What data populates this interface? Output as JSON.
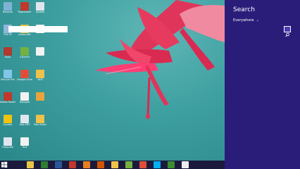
{
  "desktop_icons": [
    {
      "label": "Network",
      "color": "#7fb3d5"
    },
    {
      "label": "Pagemaker",
      "color": "#c0392b"
    },
    {
      "label": "Update",
      "color": "#dfe6ee"
    },
    {
      "label": "This PC",
      "color": "#8fb8de"
    },
    {
      "label": "photo edit",
      "color": "#e8c547"
    },
    {
      "label": "",
      "color": "#f2f2f2"
    },
    {
      "label": "Tools",
      "color": "#b03a2e"
    },
    {
      "label": "uTorrent",
      "color": "#76b041"
    },
    {
      "label": "",
      "color": "#f2f2f2"
    },
    {
      "label": "Recycle Bin",
      "color": "#7fc6e8"
    },
    {
      "label": "Google Chrome",
      "color": "#e04e39"
    },
    {
      "label": "Vol3",
      "color": "#f0c14b"
    },
    {
      "label": "Adobe Reader",
      "color": "#c0392b"
    },
    {
      "label": "Notepad",
      "color": "#f2f2f2"
    },
    {
      "label": "",
      "color": "#e8a33c"
    },
    {
      "label": "Counter",
      "color": "#f1c40f"
    },
    {
      "label": "Tally ERP",
      "color": "#dfe6ee"
    },
    {
      "label": "Files folder",
      "color": "#f0c14b"
    },
    {
      "label": "Computer",
      "color": "#dfe6ee"
    },
    {
      "label": "Text",
      "color": "#f2f2f2"
    }
  ],
  "charm": {
    "title": "Search",
    "scope": "Everywhere",
    "scope_chevron": "⌄",
    "search_value": "",
    "search_icon": "magnifier-icon"
  },
  "taskbar": {
    "start_icon": "windows-logo",
    "apps": [
      {
        "name": "file-explorer-icon",
        "color": "#e8c547"
      },
      {
        "name": "excel-icon",
        "color": "#2e7d32"
      },
      {
        "name": "word-icon",
        "color": "#2b579a"
      },
      {
        "name": "acrobat-icon",
        "color": "#c0392b"
      },
      {
        "name": "firefox-icon",
        "color": "#e67e22"
      },
      {
        "name": "powerpoint-icon",
        "color": "#d35400"
      },
      {
        "name": "folder-icon",
        "color": "#f0c14b"
      },
      {
        "name": "utorrent-icon",
        "color": "#76b041"
      },
      {
        "name": "chrome-icon",
        "color": "#e04e39"
      },
      {
        "name": "skype-icon",
        "color": "#00aff0"
      },
      {
        "name": "camtasia-icon",
        "color": "#3c8d2f"
      },
      {
        "name": "cmd-icon",
        "color": "#eeeeee"
      }
    ],
    "colors": {
      "taskbar": "#1b1a3d",
      "charm": "#2a1d7a"
    }
  }
}
